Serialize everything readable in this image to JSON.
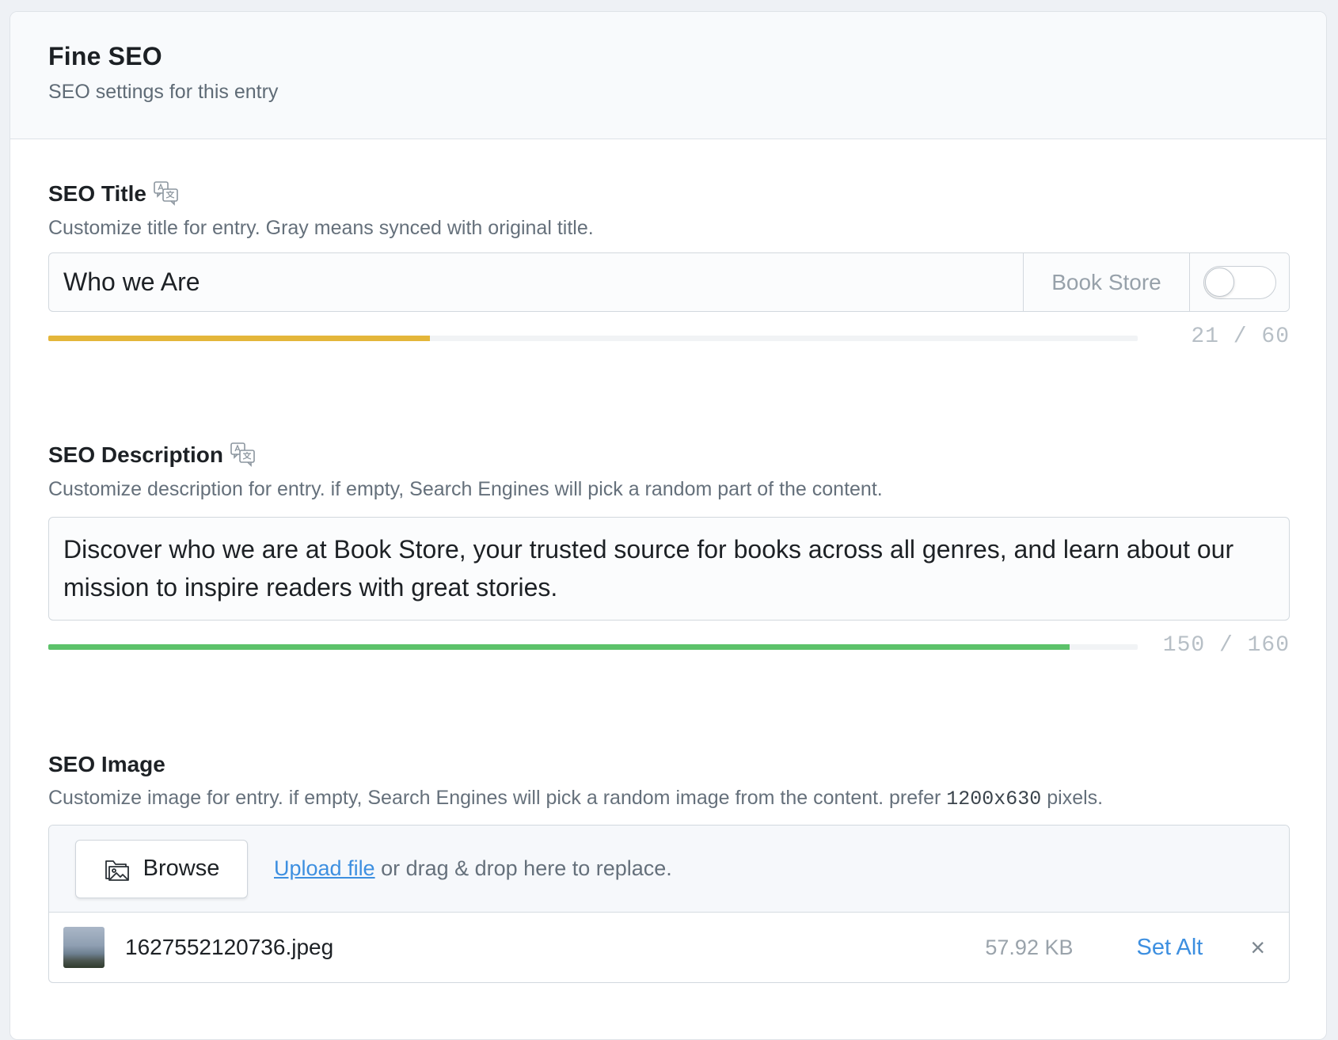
{
  "header": {
    "title": "Fine SEO",
    "subtitle": "SEO settings for this entry"
  },
  "seo_title": {
    "label": "SEO Title",
    "help": "Customize title for entry. Gray means synced with original title.",
    "value": "Who we Are",
    "suffix": "Book Store",
    "sync_toggle_on": false,
    "count": "21 / 60",
    "progress_fraction": 0.35,
    "progress_color": "#e4b63a",
    "icon": "translate-icon"
  },
  "seo_description": {
    "label": "SEO Description",
    "help": "Customize description for entry. if empty, Search Engines will pick a random part of the content.",
    "value": "Discover who we are at Book Store, your trusted source for books across all genres, and learn about our mission to inspire readers with great stories.",
    "count": "150 / 160",
    "progress_fraction": 0.9375,
    "progress_color": "#5cc26a",
    "icon": "translate-icon"
  },
  "seo_image": {
    "label": "SEO Image",
    "help_before": "Customize image for entry. if empty, Search Engines will pick a random image from the content. prefer ",
    "help_size": "1200x630",
    "help_after": " pixels.",
    "browse_label": "Browse",
    "browse_icon": "folder-image-icon",
    "upload_link": "Upload file",
    "upload_rest": " or drag & drop here to replace.",
    "file": {
      "name": "1627552120736.jpeg",
      "size": "57.92 KB",
      "set_alt_label": "Set Alt",
      "remove_symbol": "×"
    }
  },
  "colors": {
    "link": "#3d8fe0",
    "title_meter": "#e4b63a",
    "description_meter": "#5cc26a"
  }
}
